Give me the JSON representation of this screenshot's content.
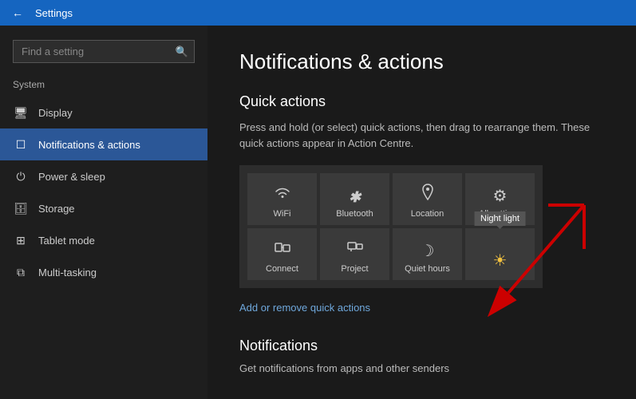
{
  "titleBar": {
    "back_label": "←",
    "title": "Settings"
  },
  "sidebar": {
    "search_placeholder": "Find a setting",
    "section_label": "System",
    "items": [
      {
        "id": "display",
        "icon": "🖥",
        "label": "Display"
      },
      {
        "id": "notifications",
        "icon": "☐",
        "label": "Notifications & actions",
        "active": true
      },
      {
        "id": "power",
        "icon": "⏻",
        "label": "Power & sleep"
      },
      {
        "id": "storage",
        "icon": "🗄",
        "label": "Storage"
      },
      {
        "id": "tablet",
        "icon": "⊞",
        "label": "Tablet mode"
      },
      {
        "id": "multitasking",
        "icon": "⧉",
        "label": "Multi-tasking"
      }
    ]
  },
  "content": {
    "page_title": "Notifications & actions",
    "quick_actions": {
      "section_title": "Quick actions",
      "description": "Press and hold (or select) quick actions, then drag to rearrange them. These quick actions appear in Action Centre.",
      "tiles": [
        {
          "id": "wifi",
          "icon": "≋",
          "label": "WiFi"
        },
        {
          "id": "bluetooth",
          "icon": "ʙ",
          "label": "Bluetooth"
        },
        {
          "id": "location",
          "icon": "⌖",
          "label": "Location"
        },
        {
          "id": "allsettings",
          "icon": "⚙",
          "label": "All settings"
        },
        {
          "id": "connect",
          "icon": "⊡",
          "label": "Connect"
        },
        {
          "id": "project",
          "icon": "⊟",
          "label": "Project"
        },
        {
          "id": "quiethours",
          "icon": "☽",
          "label": "Quiet hours"
        },
        {
          "id": "nightlight",
          "icon": "☀",
          "label": "",
          "tooltip": "Night light",
          "show_tooltip": true
        }
      ],
      "add_remove_label": "Add or remove quick actions"
    },
    "notifications": {
      "section_title": "Notifications",
      "description": "Get notifications from apps and other senders"
    }
  }
}
